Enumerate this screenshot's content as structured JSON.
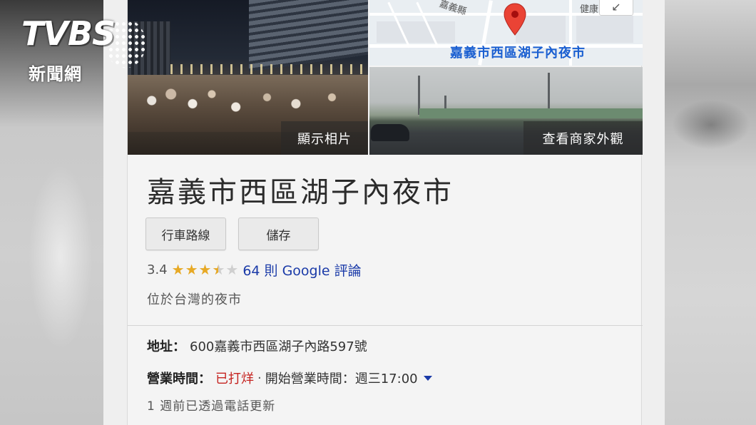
{
  "broadcast": {
    "logo_text": "TVBS",
    "logo_sub": "新聞網"
  },
  "photos": {
    "main_label": "顯示相片",
    "street_label": "查看商家外觀",
    "map": {
      "place_label": "嘉義市西區湖子內夜市",
      "road_label": "嘉義縣",
      "corner_label": "健康",
      "expand_icon": "↙"
    }
  },
  "place": {
    "title": "嘉義市西區湖子內夜市",
    "buttons": {
      "directions": "行車路線",
      "save": "儲存"
    },
    "rating": "3.4",
    "stars_value": 3.4,
    "review_link": "64 則 Google 評論",
    "subtitle": "位於台灣的夜市"
  },
  "details": {
    "address_label": "地址：",
    "address_value": "600嘉義市西區湖子內路597號",
    "hours_label": "營業時間：",
    "hours_status": "已打烊",
    "hours_sep": "·",
    "hours_next": "開始營業時間：週三17:00",
    "update_note": "1 週前已透過電話更新"
  },
  "colors": {
    "closed": "#c5221f",
    "link": "#1a3aa8",
    "star": "#e7a925",
    "pin": "#ea4335"
  }
}
